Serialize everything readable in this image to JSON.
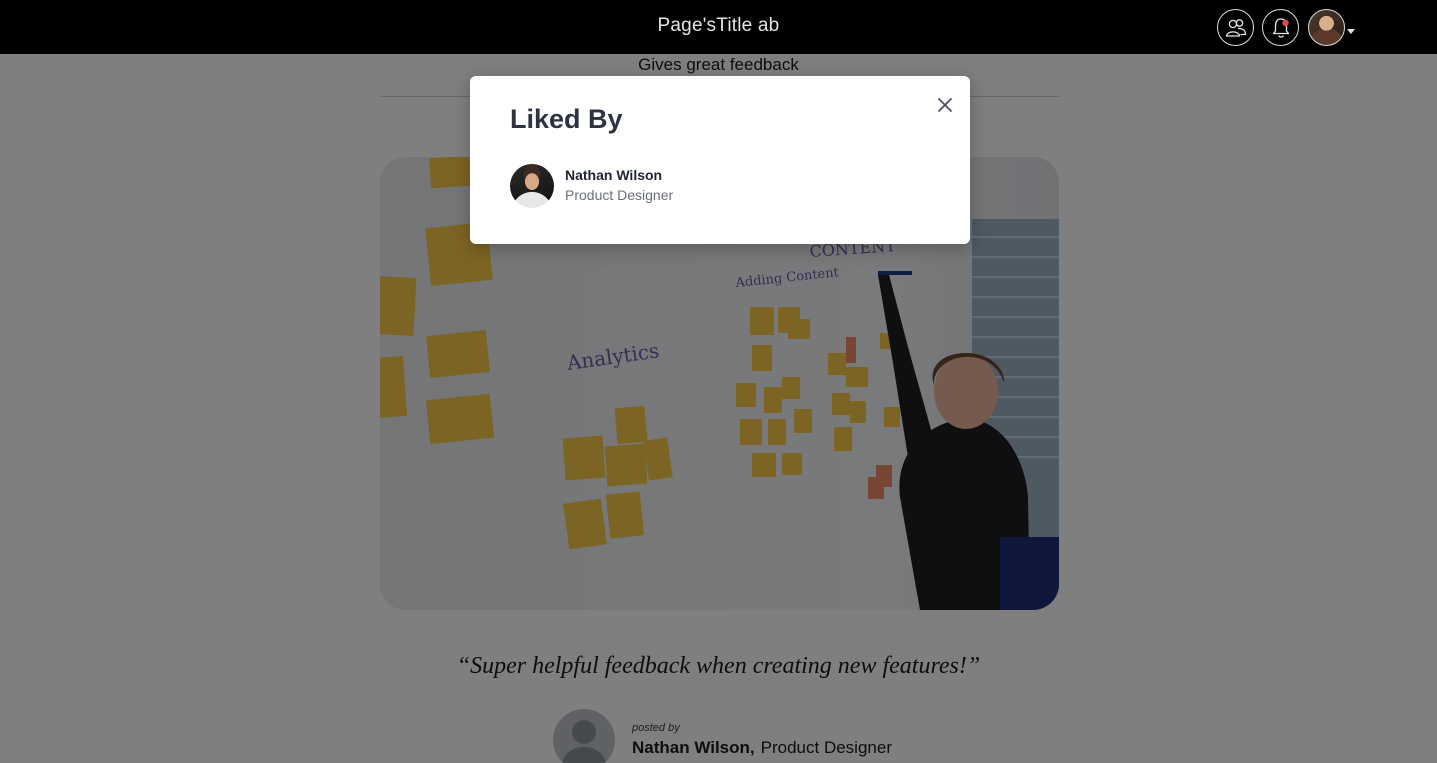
{
  "header": {
    "title": "Page'sTitle ab",
    "icons": [
      "team-icon",
      "notification-bell-icon",
      "profile-avatar-icon",
      "caret-down-icon"
    ],
    "notification_dot_color": "#d94a4a"
  },
  "content": {
    "top_text": "Gives great feedback",
    "image_icon": "whiteboard-sticky-notes-photo",
    "image_text": {
      "analytics": "Analytics",
      "adding_content": "Adding Content",
      "content": "CONTENT"
    },
    "quote": "“Super helpful feedback when creating new features!”",
    "posted_by_label": "posted by",
    "poster_name": "Nathan Wilson,",
    "poster_title": "Product Designer"
  },
  "modal": {
    "title": "Liked By",
    "close_icon": "close-icon",
    "likers": [
      {
        "name": "Nathan Wilson",
        "title": "Product Designer"
      }
    ]
  },
  "colors": {
    "topbar_background": "#000000",
    "overlay": "rgba(0,0,0,0.5)",
    "modal_title": "#2e3344",
    "sticky_note": "#f7c948"
  }
}
